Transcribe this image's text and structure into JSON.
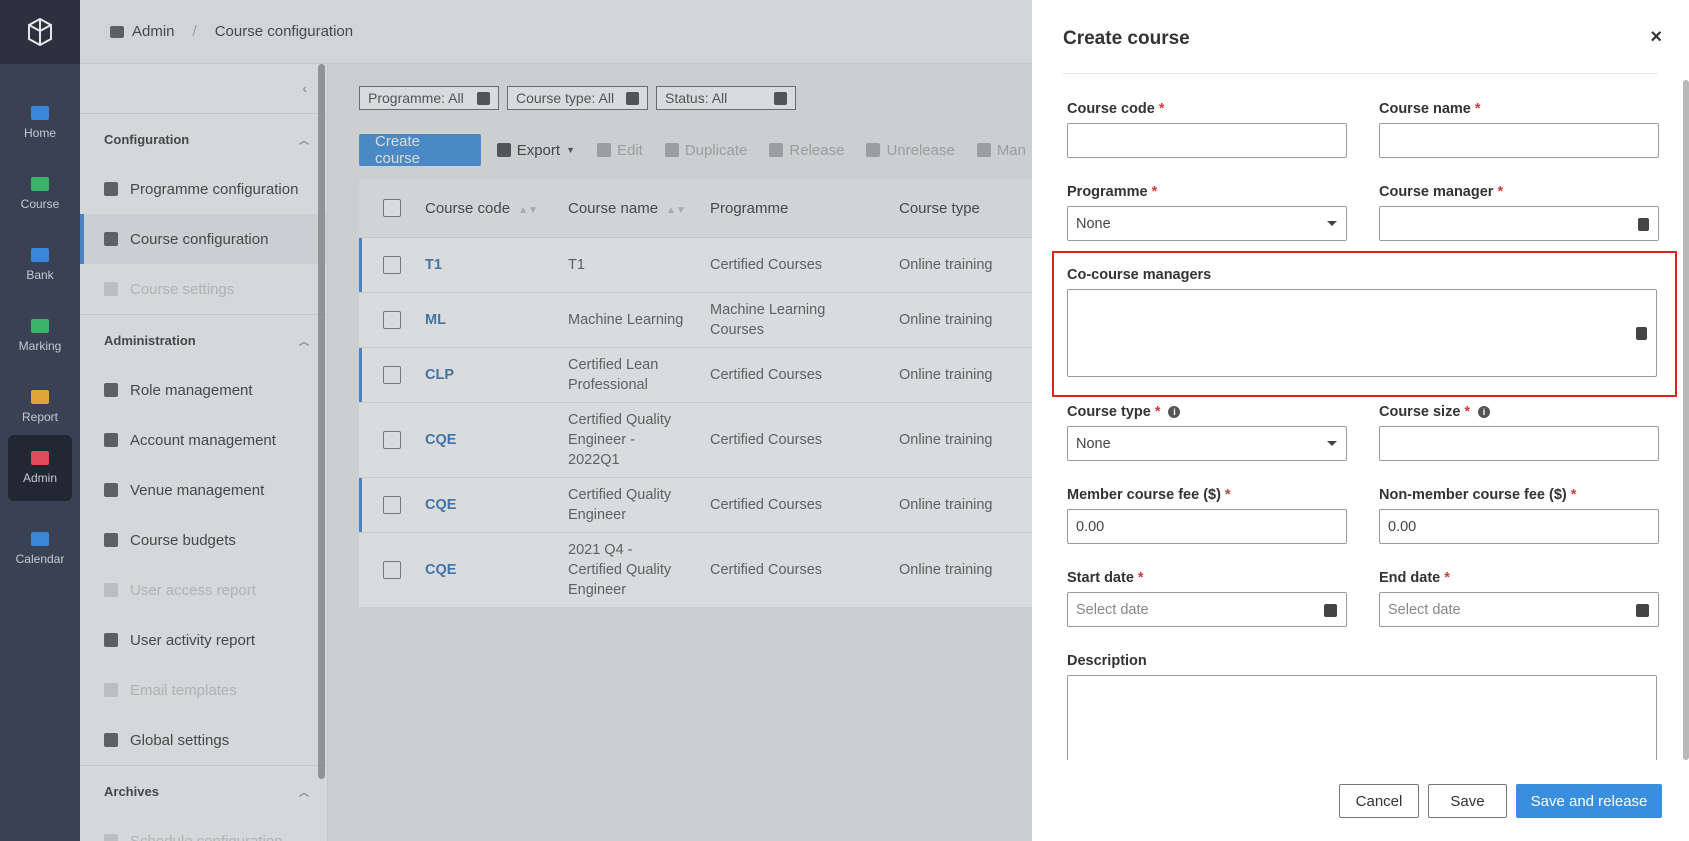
{
  "rail": {
    "items": [
      {
        "label": "Home",
        "icon": "home-icon",
        "color": "#3a86d8"
      },
      {
        "label": "Course",
        "icon": "cube-icon",
        "color": "#3bb36b"
      },
      {
        "label": "Bank",
        "icon": "bank-icon",
        "color": "#3a86d8"
      },
      {
        "label": "Marking",
        "icon": "marking-icon",
        "color": "#3bb36b"
      },
      {
        "label": "Report",
        "icon": "chart-icon",
        "color": "#e0a43a"
      },
      {
        "label": "Admin",
        "icon": "admin-icon",
        "color": "#e04b5a"
      },
      {
        "label": "Calendar",
        "icon": "calendar-icon",
        "color": "#3a86d8"
      }
    ]
  },
  "breadcrumb": {
    "root": "Admin",
    "current": "Course configuration"
  },
  "sidebar": {
    "configuration_title": "Configuration",
    "config_items": [
      "Programme configuration",
      "Course configuration",
      "Course settings"
    ],
    "administration_title": "Administration",
    "admin_items": [
      "Role management",
      "Account management",
      "Venue management",
      "Course budgets",
      "User access report",
      "User activity report",
      "Email templates",
      "Global settings"
    ],
    "archives_title": "Archives",
    "archive_items": [
      "Schedule configuration"
    ]
  },
  "filters": [
    "Programme: All",
    "Course type: All",
    "Status: All"
  ],
  "toolbar": {
    "create": "Create course",
    "export": "Export",
    "edit": "Edit",
    "duplicate": "Duplicate",
    "release": "Release",
    "unrelease": "Unrelease",
    "manage": "Man"
  },
  "table": {
    "headers": [
      "Course code",
      "Course name",
      "Programme",
      "Course type"
    ],
    "rows": [
      {
        "code": "T1",
        "name": "T1",
        "programme": "Certified Courses",
        "type": "Online training"
      },
      {
        "code": "ML",
        "name": "Machine Learning",
        "programme": "Machine Learning Courses",
        "type": "Online training"
      },
      {
        "code": "CLP",
        "name": "Certified Lean Professional",
        "programme": "Certified Courses",
        "type": "Online training"
      },
      {
        "code": "CQE",
        "name": "Certified Quality Engineer - 2022Q1",
        "programme": "Certified Courses",
        "type": "Online training"
      },
      {
        "code": "CQE",
        "name": "Certified Quality Engineer",
        "programme": "Certified Courses",
        "type": "Online training"
      },
      {
        "code": "CQE",
        "name": "2021 Q4 - Certified Quality Engineer",
        "programme": "Certified Courses",
        "type": "Online training"
      }
    ]
  },
  "drawer": {
    "title": "Create course",
    "close": "×",
    "course_code": "Course code",
    "course_name": "Course name",
    "programme": "Programme",
    "programme_value": "None",
    "course_manager": "Course manager",
    "co_managers": "Co-course managers",
    "course_type": "Course type",
    "course_type_value": "None",
    "course_size": "Course size",
    "member_fee": "Member course fee ($)",
    "member_fee_value": "0.00",
    "nonmember_fee": "Non-member course fee ($)",
    "nonmember_fee_value": "0.00",
    "start_date": "Start date",
    "end_date": "End date",
    "date_placeholder": "Select date",
    "description": "Description",
    "cancel": "Cancel",
    "save": "Save",
    "save_release": "Save and release",
    "required_mark": "*",
    "info_mark": "i"
  }
}
